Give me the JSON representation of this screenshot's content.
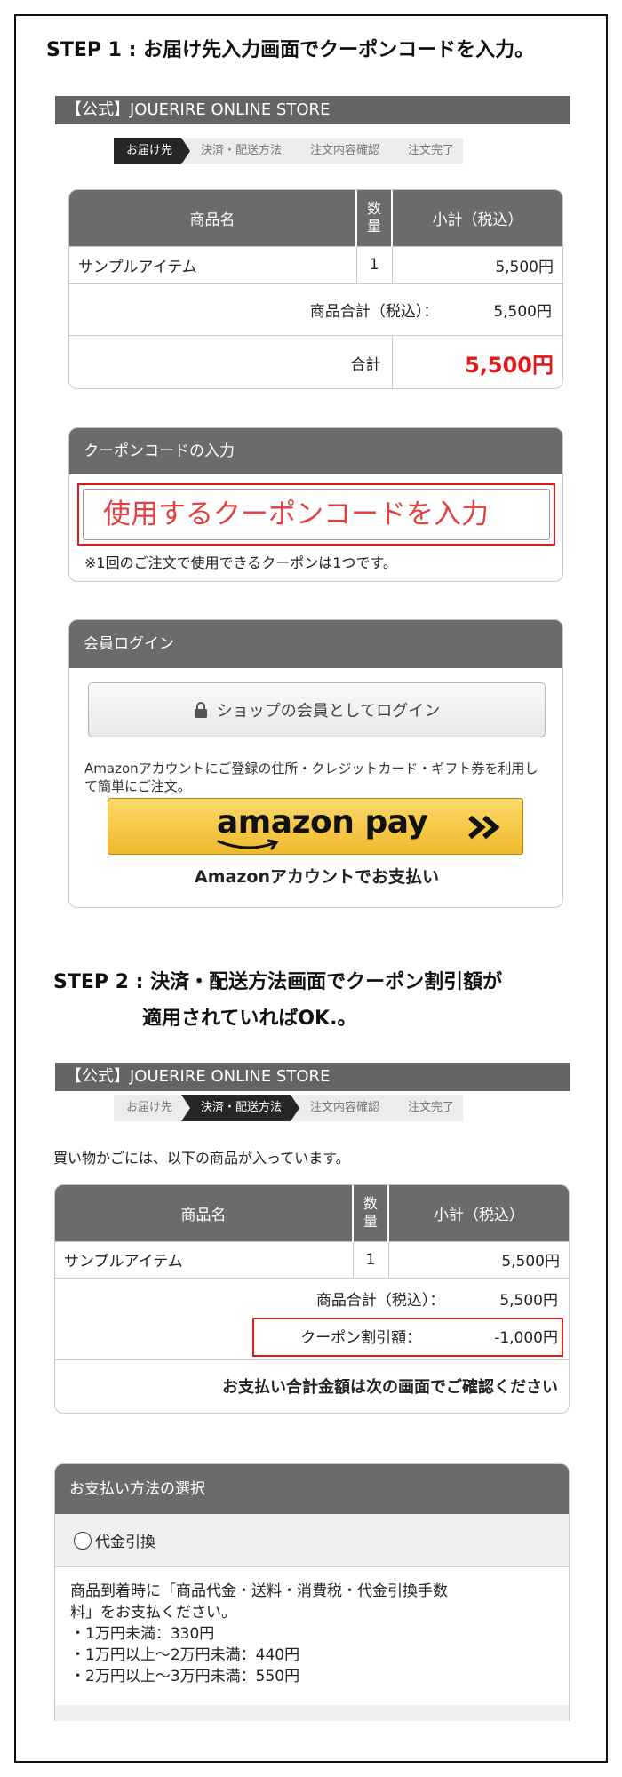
{
  "step1": {
    "title": "STEP 1 : お届け先入力画面でクーポンコードを入力。",
    "store_name": "【公式】JOUERIRE ONLINE STORE",
    "steps": [
      "お届け先",
      "決済・配送方法",
      "注文内容確認",
      "注文完了"
    ],
    "table": {
      "headers": [
        "商品名",
        "数量",
        "小計（税込）"
      ],
      "rows": [
        {
          "name": "サンプルアイテム",
          "qty": "1",
          "subtotal": "5,500円"
        }
      ],
      "subtotal_label": "商品合計（税込）：",
      "subtotal_value": "5,500円",
      "total_label": "合計",
      "total_value": "5,500円"
    },
    "coupon": {
      "header": "クーポンコードの入力",
      "placeholder": "使用するクーポンコードを入力",
      "note": "※1回のご注文で使用できるクーポンは1つです。"
    },
    "member": {
      "header": "会員ログイン",
      "login_button": "ショップの会員としてログイン",
      "amazon_desc": "Amazonアカウントにご登録の住所・クレジットカード・ギフト券を利用して簡単にご注文。",
      "amazon_logo": "amazon pay",
      "amazon_caption": "Amazonアカウントでお支払い"
    }
  },
  "step2": {
    "title_line1": "STEP 2 : 決済・配送方法画面でクーポン割引額が",
    "title_line2": "適用されていればOK.。",
    "store_name": "【公式】JOUERIRE ONLINE STORE",
    "steps": [
      "お届け先",
      "決済・配送方法",
      "注文内容確認",
      "注文完了"
    ],
    "cart_note": "買い物かごには、以下の商品が入っています。",
    "table": {
      "headers": [
        "商品名",
        "数量",
        "小計（税込）"
      ],
      "rows": [
        {
          "name": "サンプルアイテム",
          "qty": "1",
          "subtotal": "5,500円"
        }
      ],
      "subtotal_label": "商品合計（税込）：",
      "subtotal_value": "5,500円",
      "coupon_label": "クーポン割引額：",
      "coupon_value": "-1,000円",
      "confirm_text": "お支払い合計金額は次の画面でご確認ください"
    },
    "payment": {
      "header": "お支払い方法の選択",
      "option_label": "代金引換",
      "desc_line1": "商品到着時に「商品代金・送料・消費税・代金引換手数",
      "desc_line2": "料」をお支払ください。",
      "fees": [
        "・1万円未満：330円",
        "・1万円以上～2万円未満：440円",
        "・2万円以上～3万円未満：550円"
      ]
    }
  },
  "colors": {
    "header_gray": "#6b6b6b",
    "accent_red": "#e01919",
    "amazon_yellow": "#f6c63f"
  }
}
